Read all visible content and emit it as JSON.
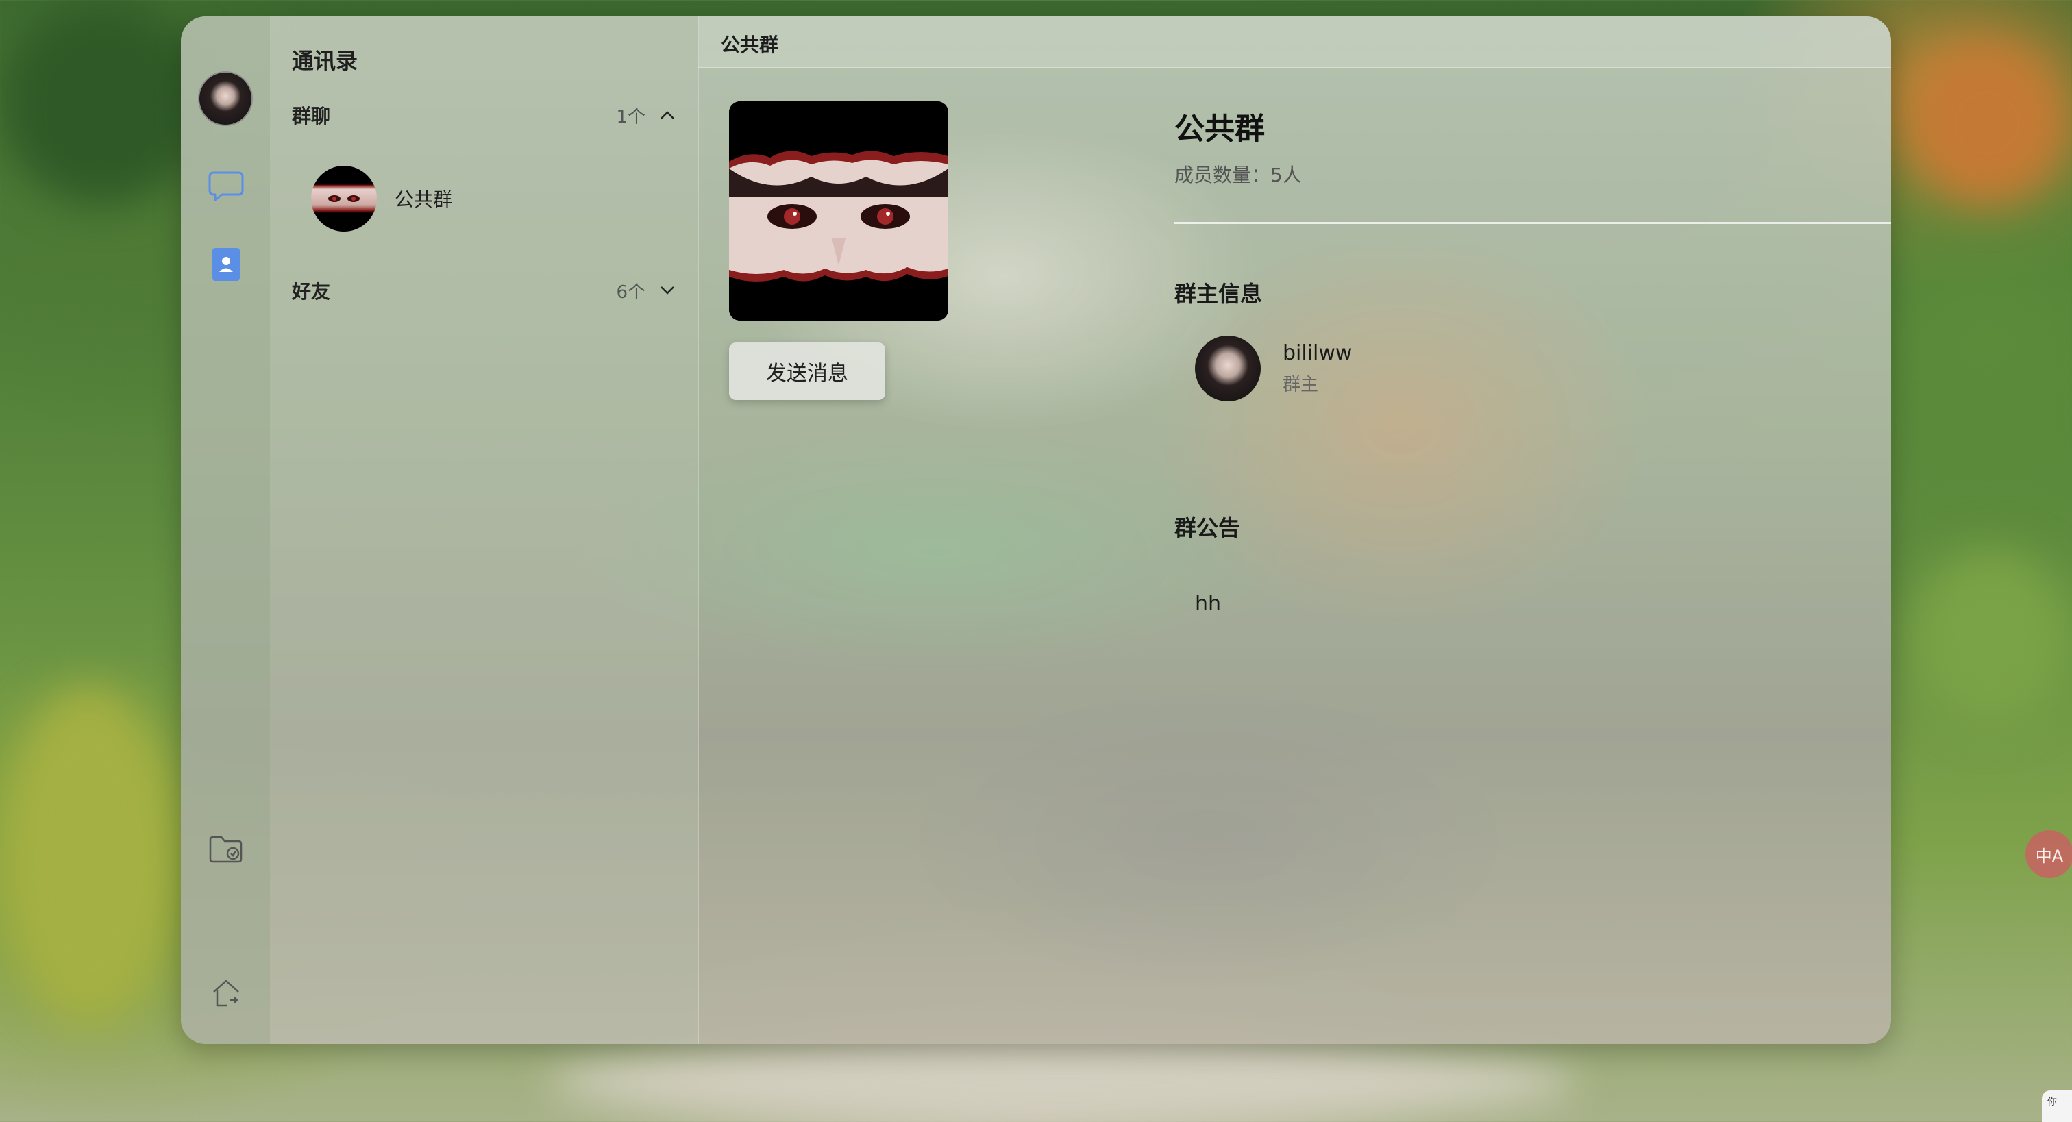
{
  "contacts": {
    "title": "通讯录",
    "groups_section": {
      "label": "群聊",
      "count": "1个",
      "expanded": true,
      "items": [
        {
          "name": "公共群"
        }
      ]
    },
    "friends_section": {
      "label": "好友",
      "count": "6个",
      "expanded": false
    }
  },
  "rail": {
    "icons": [
      "avatar",
      "chat-bubble-icon",
      "contacts-book-icon",
      "folder-icon",
      "home-icon"
    ],
    "accent": "#5b8fe6"
  },
  "detail": {
    "header_title": "公共群",
    "group_name": "公共群",
    "member_count_label": "成员数量：",
    "member_count_value": "5人",
    "send_button": "发送消息",
    "owner_section_title": "群主信息",
    "owner": {
      "name": "bililww",
      "role": "群主"
    },
    "announcement_title": "群公告",
    "announcement_text": "hh"
  },
  "floating": {
    "ime_badge": "中A",
    "corner_note": "你"
  }
}
